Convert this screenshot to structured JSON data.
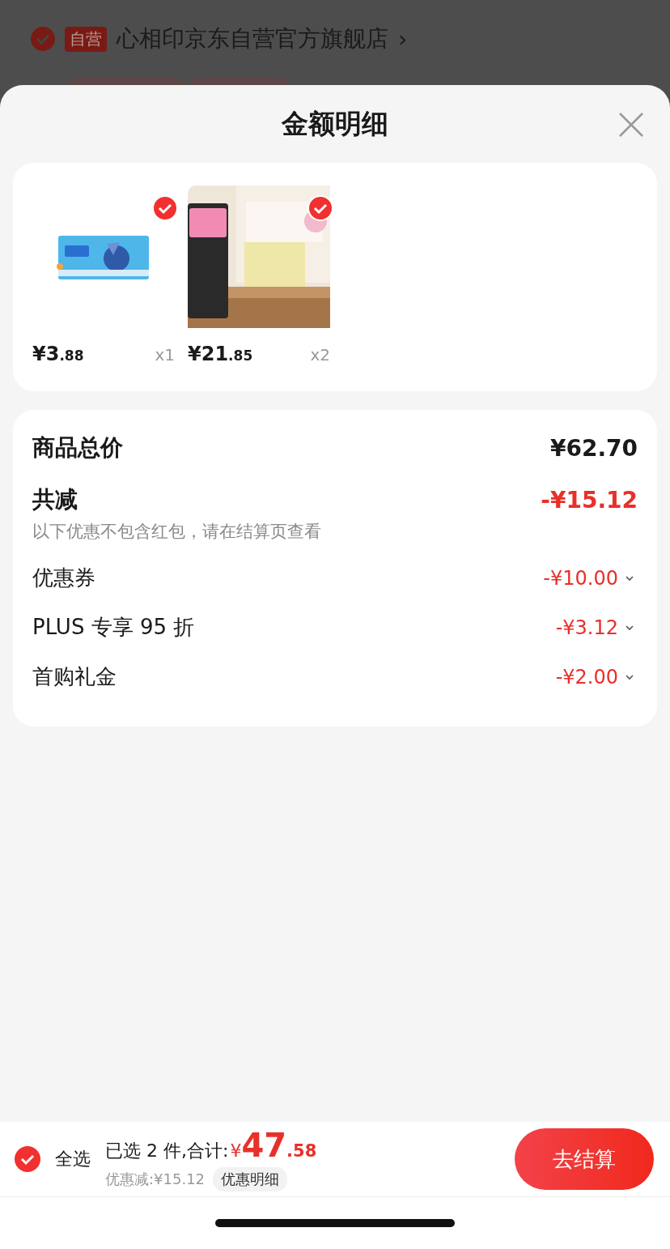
{
  "store": {
    "checked": true,
    "badge": "自营",
    "name": "心相印京东自营官方旗舰店",
    "chevron": "›"
  },
  "sheet": {
    "title": "金额明细"
  },
  "products": [
    {
      "checked": true,
      "price_main": "¥3",
      "price_decimal": ".88",
      "quantity": "x1",
      "kind": "picture"
    },
    {
      "checked": true,
      "price_main": "¥21",
      "price_decimal": ".85",
      "quantity": "x2",
      "kind": "picture"
    }
  ],
  "summary": [
    {
      "kind": "total",
      "label": "商品总价",
      "value": "¥62.70"
    },
    {
      "kind": "reduction",
      "label": "共减",
      "value": "-¥15.12",
      "note": "以下优惠不包含红包，请在结算页查看"
    },
    {
      "kind": "discount",
      "label": "优惠券",
      "value": "-¥10.00"
    },
    {
      "kind": "discount",
      "label": "PLUS 专享 95 折",
      "value": "-¥3.12"
    },
    {
      "kind": "discount",
      "label": "首购礼金",
      "value": "-¥2.00"
    }
  ],
  "footer": {
    "select_all": {
      "label": "全选",
      "checked": true
    },
    "selected_text": "已选 2 件,合计:",
    "currency": "¥",
    "total_main": "47",
    "total_decimal": ".58",
    "discount_text": "优惠减:¥15.12",
    "detail_button": "优惠明细",
    "checkout_button": "去结算"
  }
}
